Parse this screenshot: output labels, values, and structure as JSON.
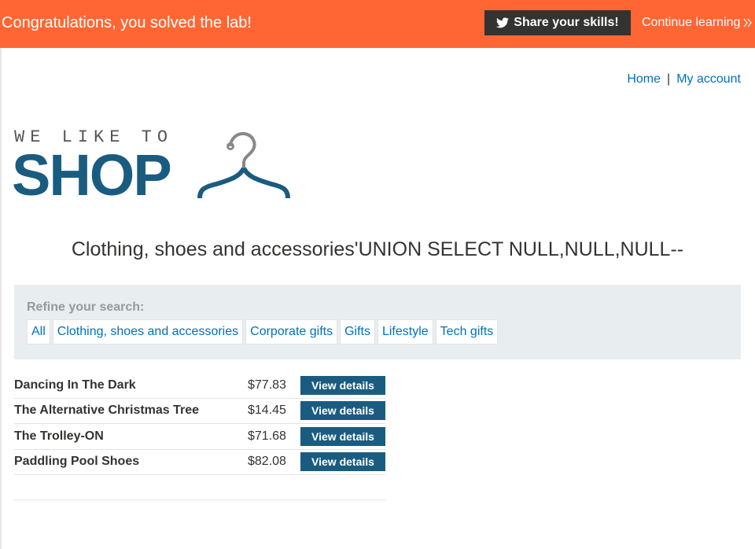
{
  "banner": {
    "message": "Congratulations, you solved the lab!",
    "share_label": "Share your skills!",
    "share_icon": "twitter-icon",
    "continue_label": "Continue learning",
    "continue_icon": "double-chevron-right-icon",
    "background_color": "#ff6633"
  },
  "topnav": {
    "home_label": "Home",
    "separator": "|",
    "account_label": "My account"
  },
  "logo": {
    "tagline": "WE LIKE TO",
    "brand": "SHOP",
    "icon": "hanger-icon",
    "brand_color": "#1a5c80"
  },
  "heading": "Clothing, shoes and accessories'UNION SELECT NULL,NULL,NULL--",
  "filter": {
    "title": "Refine your search:",
    "categories": [
      "All",
      "Clothing, shoes and accessories",
      "Corporate gifts",
      "Gifts",
      "Lifestyle",
      "Tech gifts"
    ]
  },
  "products": [
    {
      "name": "Dancing In The Dark",
      "price": "$77.83",
      "button": "View details"
    },
    {
      "name": "The Alternative Christmas Tree",
      "price": "$14.45",
      "button": "View details"
    },
    {
      "name": "The Trolley-ON",
      "price": "$71.68",
      "button": "View details"
    },
    {
      "name": "Paddling Pool Shoes",
      "price": "$82.08",
      "button": "View details"
    }
  ]
}
